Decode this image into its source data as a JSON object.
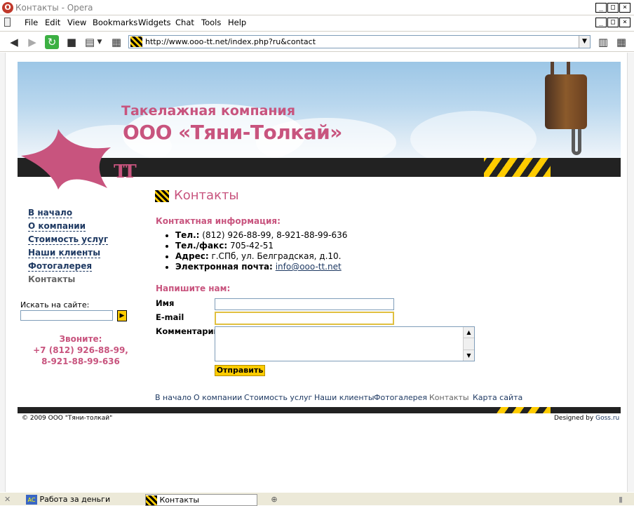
{
  "window": {
    "title": "Контакты - Opera",
    "minimize": "_",
    "maximize": "□",
    "close": "×"
  },
  "menu": [
    "File",
    "Edit",
    "View",
    "Bookmarks",
    "Widgets",
    "Chat",
    "Tools",
    "Help"
  ],
  "address": {
    "url": "http://www.ooo-tt.net/index.php?ru&contact"
  },
  "header": {
    "line1": "Такелажная компания",
    "line2": "ООО «Тяни-Толкай»",
    "logo_letters": "ТТ"
  },
  "nav": {
    "items": [
      "В начало",
      "О компании",
      "Стоимость услуг",
      "Наши клиенты",
      "Фотогалерея"
    ],
    "current": "Контакты"
  },
  "search": {
    "label": "Искать на сайте:",
    "value": "",
    "button": "▶"
  },
  "call": {
    "title": "Звоните:",
    "phone1": "+7 (812) 926-88-99,",
    "phone2": "8-921-88-99-636"
  },
  "content": {
    "title": "Контакты",
    "info_heading": "Контактная информация:",
    "contacts": [
      {
        "label": "Тел.:",
        "value": " (812) 926-88-99, 8-921-88-99-636"
      },
      {
        "label": "Тел./факс:",
        "value": " 705-42-51"
      },
      {
        "label": "Адрес:",
        "value": " г.СПб, ул. Белградская, д.10."
      },
      {
        "label": "Электронная почта:",
        "value": " ",
        "link": "info@ooo-tt.net"
      }
    ],
    "write_heading": "Напишите нам:",
    "form": {
      "name_label": "Имя",
      "email_label": "E-mail",
      "comment_label": "Комментарий",
      "name_value": "",
      "email_value": "",
      "comment_value": "",
      "submit": "Отправить"
    }
  },
  "footer_nav": {
    "items": [
      "В начало",
      "О компании",
      "Стоимость услуг",
      "Наши клиенты",
      "Фотогалерея",
      "Контакты",
      "Карта сайта"
    ]
  },
  "footer": {
    "copyright": "© 2009 ООО \"Тяни-толкай\"",
    "designed_prefix": "Designed by ",
    "designed_link": "Goss.ru"
  },
  "taskbar": {
    "task1": "Работа за деньги",
    "task2": "Контакты"
  },
  "colors": {
    "accent": "#c8547e",
    "link": "#1f3a63",
    "yellow": "#ffcc00",
    "dark": "#222222"
  }
}
